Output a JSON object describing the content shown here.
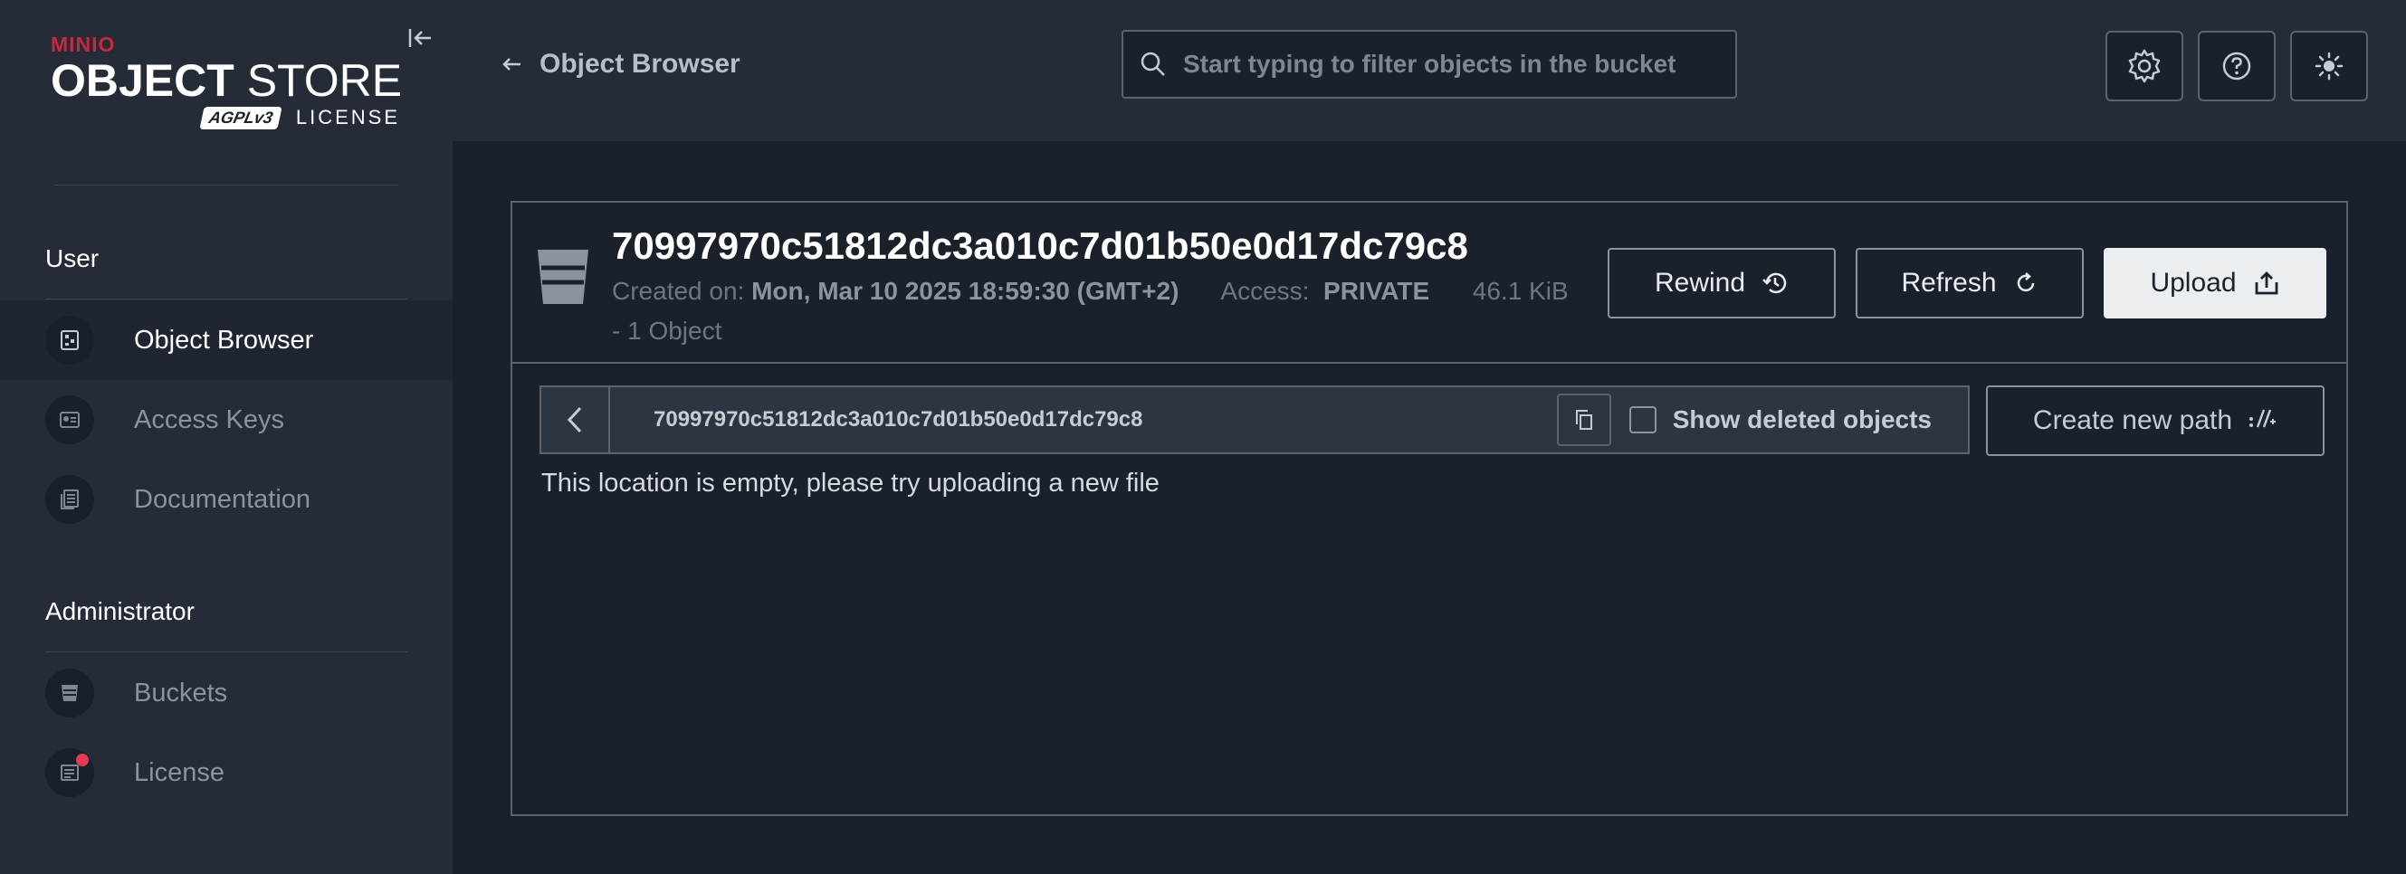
{
  "sidebar": {
    "logo": {
      "brand": "MINIO",
      "product_bold": "OBJECT",
      "product_light": "STORE",
      "badge": "AGPLv3",
      "license_text": "LICENSE"
    },
    "sections": [
      {
        "label": "User",
        "items": [
          {
            "label": "Object Browser",
            "icon": "object-browser-icon",
            "active": true
          },
          {
            "label": "Access Keys",
            "icon": "access-keys-icon",
            "active": false
          },
          {
            "label": "Documentation",
            "icon": "documentation-icon",
            "active": false
          }
        ]
      },
      {
        "label": "Administrator",
        "items": [
          {
            "label": "Buckets",
            "icon": "bucket-icon",
            "active": false
          },
          {
            "label": "License",
            "icon": "license-icon",
            "active": false,
            "badge": true
          }
        ]
      }
    ]
  },
  "header": {
    "back_label": "Object Browser",
    "search_placeholder": "Start typing to filter objects in the bucket",
    "buttons": [
      "settings-icon",
      "help-icon",
      "theme-toggle-icon"
    ]
  },
  "bucket": {
    "name": "70997970c51812dc3a010c7d01b50e0d17dc79c8",
    "created_label": "Created on:",
    "created_value": "Mon, Mar 10 2025 18:59:30 (GMT+2)",
    "access_label": "Access:",
    "access_value": "PRIVATE",
    "size": "46.1 KiB",
    "objects": "- 1 Object",
    "actions": {
      "rewind": "Rewind",
      "refresh": "Refresh",
      "upload": "Upload"
    }
  },
  "browser": {
    "path": "70997970c51812dc3a010c7d01b50e0d17dc79c8",
    "show_deleted_label": "Show deleted objects",
    "create_path_label": "Create new path",
    "empty_message": "This location is empty, please try uploading a new file"
  },
  "colors": {
    "sidebar_bg": "#252c38",
    "main_bg": "#1b212b",
    "brand_red": "#c8283e",
    "badge_red": "#e53a50",
    "primary_button": "#eaeef1"
  }
}
